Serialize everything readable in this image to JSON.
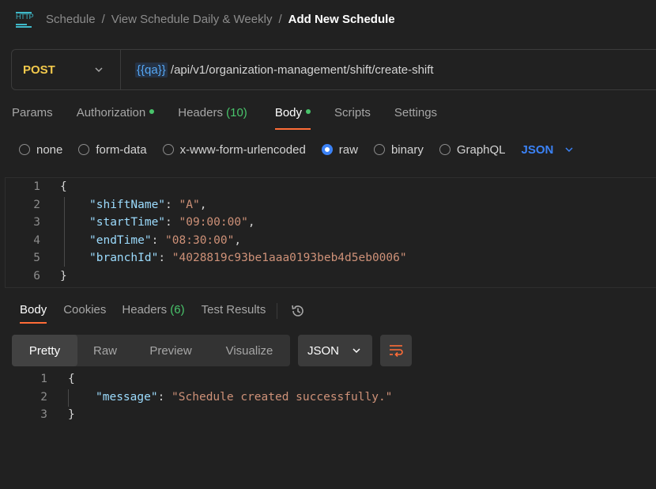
{
  "breadcrumb": {
    "icon_text": "HTTP",
    "items": [
      "Schedule",
      "View Schedule Daily & Weekly"
    ],
    "current": "Add New Schedule",
    "separator": "/"
  },
  "request": {
    "method": "POST",
    "url_variable": "{{qa}}",
    "url_path": "/api/v1/organization-management/shift/create-shift"
  },
  "request_tabs": {
    "params": "Params",
    "authorization": "Authorization",
    "headers": "Headers",
    "headers_count": "(10)",
    "body": "Body",
    "scripts": "Scripts",
    "settings": "Settings",
    "active": "Body"
  },
  "body_types": {
    "none": "none",
    "form_data": "form-data",
    "urlencoded": "x-www-form-urlencoded",
    "raw": "raw",
    "binary": "binary",
    "graphql": "GraphQL",
    "selected": "raw",
    "format": "JSON"
  },
  "request_body": {
    "line_numbers": [
      "1",
      "2",
      "3",
      "4",
      "5",
      "6"
    ],
    "open_brace": "{",
    "close_brace": "}",
    "fields": [
      {
        "key": "\"shiftName\"",
        "value": "\"A\"",
        "comma": ","
      },
      {
        "key": "\"startTime\"",
        "value": "\"09:00:00\"",
        "comma": ","
      },
      {
        "key": "\"endTime\"",
        "value": "\"08:30:00\"",
        "comma": ","
      },
      {
        "key": "\"branchId\"",
        "value": "\"4028819c93be1aaa0193beb4d5eb0006\"",
        "comma": ""
      }
    ]
  },
  "response_tabs": {
    "body": "Body",
    "cookies": "Cookies",
    "headers": "Headers",
    "headers_count": "(6)",
    "test_results": "Test Results",
    "active": "Body"
  },
  "response_view": {
    "pretty": "Pretty",
    "raw": "Raw",
    "preview": "Preview",
    "visualize": "Visualize",
    "active": "Pretty",
    "format": "JSON"
  },
  "response_body": {
    "line_numbers": [
      "1",
      "2",
      "3"
    ],
    "open_brace": "{",
    "close_brace": "}",
    "key": "\"message\"",
    "value": "\"Schedule created successfully.\""
  },
  "colors": {
    "background": "#212121",
    "accent_tab": "#ff6c37",
    "method_post": "#f2c94c",
    "variable": "#56a8f5",
    "json_key": "#9cdcfe",
    "json_string": "#ce9178",
    "status_dot": "#49c46b",
    "radio_selected": "#3b82f6"
  },
  "icons": [
    "http-icon",
    "chevron-down-icon",
    "history-icon",
    "wrap-lines-icon"
  ]
}
